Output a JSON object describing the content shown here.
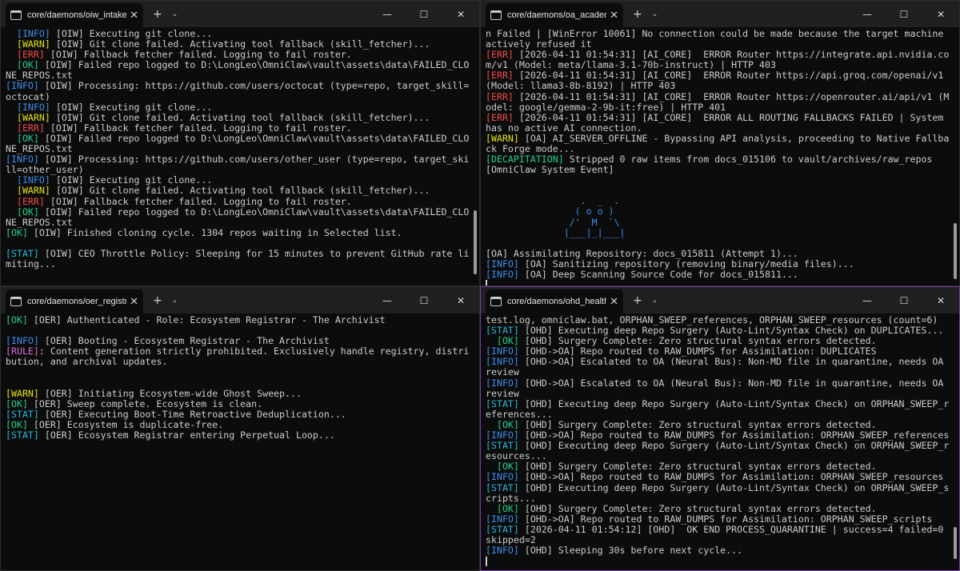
{
  "colors": {
    "INFO": "#3b8eea",
    "WARN": "#e5e510",
    "ERR": "#f14c4c",
    "OK": "#23d18b",
    "STAT": "#29b8db",
    "RULE": "#d670d6",
    "DECAPITATION": "#23d18b",
    "text": "#cccccc"
  },
  "windows": [
    {
      "id": "w1",
      "tab_title": "core/daemons/oiw_intake.py",
      "lines": [
        {
          "indent": true,
          "tag": "[INFO]",
          "level": "INFO",
          "text": " [OIW] Executing git clone..."
        },
        {
          "indent": true,
          "tag": "[WARN]",
          "level": "WARN",
          "text": " [OIW] Git clone failed. Activating tool fallback (skill_fetcher)..."
        },
        {
          "indent": true,
          "tag": "[ERR]",
          "level": "ERR",
          "text": " [OIW] Fallback fetcher failed. Logging to fail roster."
        },
        {
          "indent": true,
          "tag": "[OK]",
          "level": "OK",
          "text": " [OIW] Failed repo logged to D:\\LongLeo\\OmniClaw\\vault\\assets\\data\\FAILED_CLONE_REPOS.txt"
        },
        {
          "indent": false,
          "tag": "[INFO]",
          "level": "INFO",
          "text": " [OIW] Processing: https://github.com/users/octocat (type=repo, target_skill=octocat)"
        },
        {
          "indent": true,
          "tag": "[INFO]",
          "level": "INFO",
          "text": " [OIW] Executing git clone..."
        },
        {
          "indent": true,
          "tag": "[WARN]",
          "level": "WARN",
          "text": " [OIW] Git clone failed. Activating tool fallback (skill_fetcher)..."
        },
        {
          "indent": true,
          "tag": "[ERR]",
          "level": "ERR",
          "text": " [OIW] Fallback fetcher failed. Logging to fail roster."
        },
        {
          "indent": true,
          "tag": "[OK]",
          "level": "OK",
          "text": " [OIW] Failed repo logged to D:\\LongLeo\\OmniClaw\\vault\\assets\\data\\FAILED_CLONE_REPOS.txt"
        },
        {
          "indent": false,
          "tag": "[INFO]",
          "level": "INFO",
          "text": " [OIW] Processing: https://github.com/users/other_user (type=repo, target_skill=other_user)"
        },
        {
          "indent": true,
          "tag": "[INFO]",
          "level": "INFO",
          "text": " [OIW] Executing git clone..."
        },
        {
          "indent": true,
          "tag": "[WARN]",
          "level": "WARN",
          "text": " [OIW] Git clone failed. Activating tool fallback (skill_fetcher)..."
        },
        {
          "indent": true,
          "tag": "[ERR]",
          "level": "ERR",
          "text": " [OIW] Fallback fetcher failed. Logging to fail roster."
        },
        {
          "indent": true,
          "tag": "[OK]",
          "level": "OK",
          "text": " [OIW] Failed repo logged to D:\\LongLeo\\OmniClaw\\vault\\assets\\data\\FAILED_CLONE_REPOS.txt"
        },
        {
          "indent": false,
          "tag": "[OK]",
          "level": "OK",
          "text": " [OIW] Finished cloning cycle. 1304 repos waiting in Selected list."
        },
        {
          "indent": false,
          "tag": "",
          "level": "",
          "text": ""
        },
        {
          "indent": false,
          "tag": "[STAT]",
          "level": "STAT",
          "text": " [OIW] CEO Throttle Policy: Sleeping for 15 minutes to prevent GitHub rate limiting..."
        }
      ]
    },
    {
      "id": "w2",
      "tab_title": "core/daemons/oa_academy.py",
      "lines": [
        {
          "indent": false,
          "tag": "",
          "level": "",
          "text": "n Failed | [WinError 10061] No connection could be made because the target machine actively refused it"
        },
        {
          "indent": false,
          "tag": "[ERR]",
          "level": "ERR",
          "text": " [2026-04-11 01:54:31] [AI_CORE]  ERROR Router https://integrate.api.nvidia.com/v1 (Model: meta/llama-3.1-70b-instruct) | HTTP 403"
        },
        {
          "indent": false,
          "tag": "[ERR]",
          "level": "ERR",
          "text": " [2026-04-11 01:54:31] [AI_CORE]  ERROR Router https://api.groq.com/openai/v1 (Model: llama3-8b-8192) | HTTP 403"
        },
        {
          "indent": false,
          "tag": "[ERR]",
          "level": "ERR",
          "text": " [2026-04-11 01:54:31] [AI_CORE]  ERROR Router https://openrouter.ai/api/v1 (Model: google/gemma-2-9b-it:free) | HTTP 401"
        },
        {
          "indent": false,
          "tag": "[ERR]",
          "level": "ERR",
          "text": " [2026-04-11 01:54:31] [AI_CORE]  ERROR ALL ROUTING FALLBACKS FAILED | System has no active AI connection."
        },
        {
          "indent": false,
          "tag": "[WARN]",
          "level": "WARN",
          "text": " [OA] AI_SERVER_OFFLINE - Bypassing API analysis, proceeding to Native Fallback Forge mode..."
        },
        {
          "indent": false,
          "tag": "[DECAPITATION]",
          "level": "DECAPITATION",
          "text": " Stripped 0 raw items from docs_015106 to vault/archives/raw_repos"
        },
        {
          "indent": false,
          "tag": "",
          "level": "",
          "text": "[OmniClaw System Event]"
        }
      ],
      "ascii_art": "                 .  _  .\n                ( o o )\n               /'  M  `\\\n              |___|_|___|",
      "lines_after": [
        {
          "indent": false,
          "tag": "",
          "level": "",
          "text": "[OA] Assimilating Repository: docs_015811 (Attempt 1)..."
        },
        {
          "indent": false,
          "tag": "[INFO]",
          "level": "INFO",
          "text": " [OA] Sanitizing repository (removing binary/media files)..."
        },
        {
          "indent": false,
          "tag": "[INFO]",
          "level": "INFO",
          "text": " [OA] Deep Scanning Source Code for docs_015811..."
        }
      ]
    },
    {
      "id": "w3",
      "tab_title": "core/daemons/oer_registry.py",
      "lines": [
        {
          "indent": false,
          "tag": "[OK]",
          "level": "OK",
          "text": " [OER] Authenticated - Role: Ecosystem Registrar - The Archivist"
        },
        {
          "indent": false,
          "tag": "",
          "level": "",
          "text": ""
        },
        {
          "indent": false,
          "tag": "[INFO]",
          "level": "INFO",
          "text": " [OER] Booting - Ecosystem Registrar - The Archivist"
        },
        {
          "indent": false,
          "tag": "[RULE]",
          "level": "RULE",
          "text": ": Content generation strictly prohibited. Exclusively handle registry, distribution, and archival updates."
        },
        {
          "indent": false,
          "tag": "",
          "level": "",
          "text": ""
        },
        {
          "indent": false,
          "tag": "",
          "level": "",
          "text": ""
        },
        {
          "indent": false,
          "tag": "[WARN]",
          "level": "WARN",
          "text": " [OER] Initiating Ecosystem-wide Ghost Sweep..."
        },
        {
          "indent": false,
          "tag": "[OK]",
          "level": "OK",
          "text": " [OER] Sweep complete. Ecosystem is clean."
        },
        {
          "indent": false,
          "tag": "[STAT]",
          "level": "STAT",
          "text": " [OER] Executing Boot-Time Retroactive Deduplication..."
        },
        {
          "indent": false,
          "tag": "[OK]",
          "level": "OK",
          "text": " [OER] Ecosystem is duplicate-free."
        },
        {
          "indent": false,
          "tag": "[STAT]",
          "level": "STAT",
          "text": " [OER] Ecosystem Registrar entering Perpetual Loop..."
        }
      ]
    },
    {
      "id": "w4",
      "tab_title": "core/daemons/ohd_health.py",
      "lines": [
        {
          "indent": false,
          "tag": "",
          "level": "",
          "text": "test.log, omniclaw.bat, ORPHAN_SWEEP_references, ORPHAN_SWEEP_resources (count=6)"
        },
        {
          "indent": false,
          "tag": "[STAT]",
          "level": "STAT",
          "text": " [OHD] Executing deep Repo Surgery (Auto-Lint/Syntax Check) on DUPLICATES..."
        },
        {
          "indent": true,
          "tag": "[OK]",
          "level": "OK",
          "text": " [OHD] Surgery Complete: Zero structural syntax errors detected."
        },
        {
          "indent": false,
          "tag": "[INFO]",
          "level": "INFO",
          "text": " [OHD->OA] Repo routed to RAW_DUMPS for Assimilation: DUPLICATES"
        },
        {
          "indent": false,
          "tag": "[INFO]",
          "level": "INFO",
          "text": " [OHD->OA] Escalated to OA (Neural Bus): Non-MD file in quarantine, needs OA review"
        },
        {
          "indent": false,
          "tag": "[INFO]",
          "level": "INFO",
          "text": " [OHD->OA] Escalated to OA (Neural Bus): Non-MD file in quarantine, needs OA review"
        },
        {
          "indent": false,
          "tag": "[STAT]",
          "level": "STAT",
          "text": " [OHD] Executing deep Repo Surgery (Auto-Lint/Syntax Check) on ORPHAN_SWEEP_references..."
        },
        {
          "indent": true,
          "tag": "[OK]",
          "level": "OK",
          "text": " [OHD] Surgery Complete: Zero structural syntax errors detected."
        },
        {
          "indent": false,
          "tag": "[INFO]",
          "level": "INFO",
          "text": " [OHD->OA] Repo routed to RAW_DUMPS for Assimilation: ORPHAN_SWEEP_references"
        },
        {
          "indent": false,
          "tag": "[STAT]",
          "level": "STAT",
          "text": " [OHD] Executing deep Repo Surgery (Auto-Lint/Syntax Check) on ORPHAN_SWEEP_resources..."
        },
        {
          "indent": true,
          "tag": "[OK]",
          "level": "OK",
          "text": " [OHD] Surgery Complete: Zero structural syntax errors detected."
        },
        {
          "indent": false,
          "tag": "[INFO]",
          "level": "INFO",
          "text": " [OHD->OA] Repo routed to RAW_DUMPS for Assimilation: ORPHAN_SWEEP_resources"
        },
        {
          "indent": false,
          "tag": "[STAT]",
          "level": "STAT",
          "text": " [OHD] Executing deep Repo Surgery (Auto-Lint/Syntax Check) on ORPHAN_SWEEP_scripts..."
        },
        {
          "indent": true,
          "tag": "[OK]",
          "level": "OK",
          "text": " [OHD] Surgery Complete: Zero structural syntax errors detected."
        },
        {
          "indent": false,
          "tag": "[INFO]",
          "level": "INFO",
          "text": " [OHD->OA] Repo routed to RAW_DUMPS for Assimilation: ORPHAN_SWEEP_scripts"
        },
        {
          "indent": false,
          "tag": "[STAT]",
          "level": "STAT",
          "text": " [2026-04-11 01:54:12] [OHD]  OK END PROCESS_QUARANTINE | success=4 failed=0 skipped=2"
        },
        {
          "indent": false,
          "tag": "[INFO]",
          "level": "INFO",
          "text": " [OHD] Sleeping 30s before next cycle..."
        }
      ]
    }
  ],
  "icons": {
    "tab": "terminal-icon",
    "close": "close-icon",
    "new_tab": "plus-icon",
    "dropdown": "chevron-down-icon",
    "minimize": "minimize-icon",
    "maximize": "maximize-icon",
    "window_close": "window-close-icon"
  },
  "glyphs": {
    "close": "✕",
    "new_tab": "+",
    "dropdown": "⌄",
    "minimize": "—",
    "maximize": "☐",
    "window_close": "✕"
  }
}
